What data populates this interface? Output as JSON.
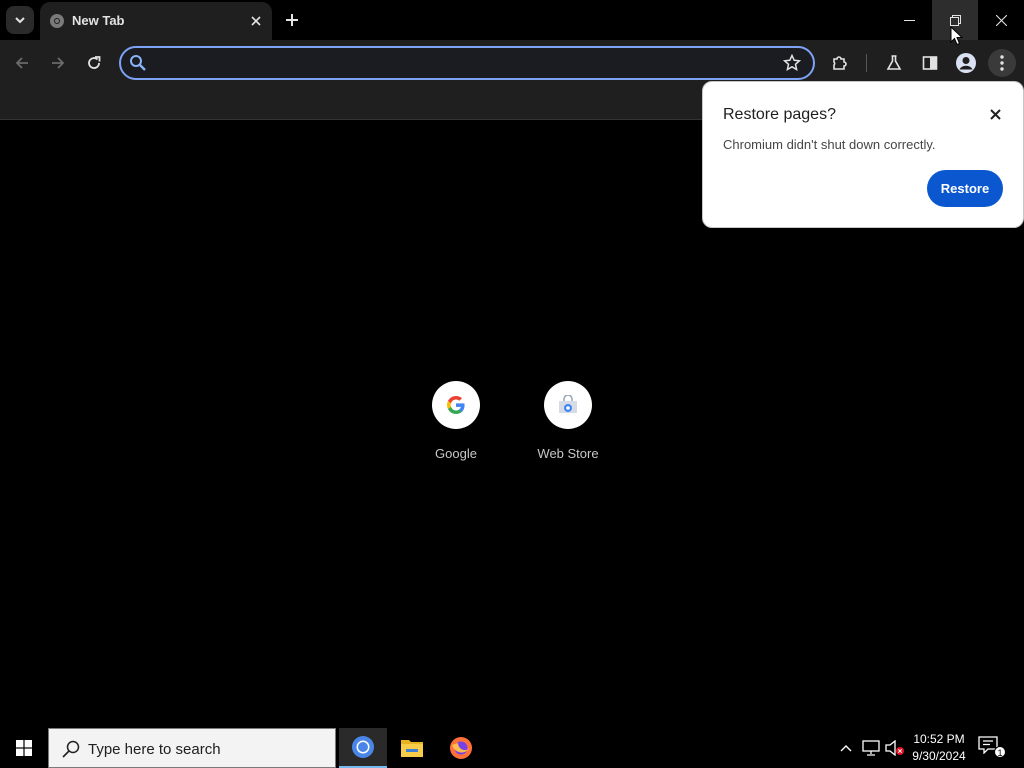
{
  "browser": {
    "tab": {
      "title": "New Tab"
    },
    "omnibox": {
      "value": "",
      "placeholder": ""
    }
  },
  "new_tab_page": {
    "shortcuts": [
      {
        "label": "Google",
        "icon": "google-g-icon"
      },
      {
        "label": "Web Store",
        "icon": "web-store-icon"
      }
    ]
  },
  "restore_bubble": {
    "title": "Restore pages?",
    "message": "Chromium didn't shut down correctly.",
    "button_label": "Restore"
  },
  "taskbar": {
    "search_placeholder": "Type here to search",
    "apps": [
      "chromium-icon",
      "file-explorer-icon",
      "firefox-icon"
    ],
    "clock": {
      "time": "10:52 PM",
      "date": "9/30/2024"
    },
    "notification_count": "1"
  },
  "colors": {
    "accent_blue": "#0b57d0",
    "omnibox_focus": "#7ca3f5",
    "toolbar_bg": "#1f1f1f"
  }
}
